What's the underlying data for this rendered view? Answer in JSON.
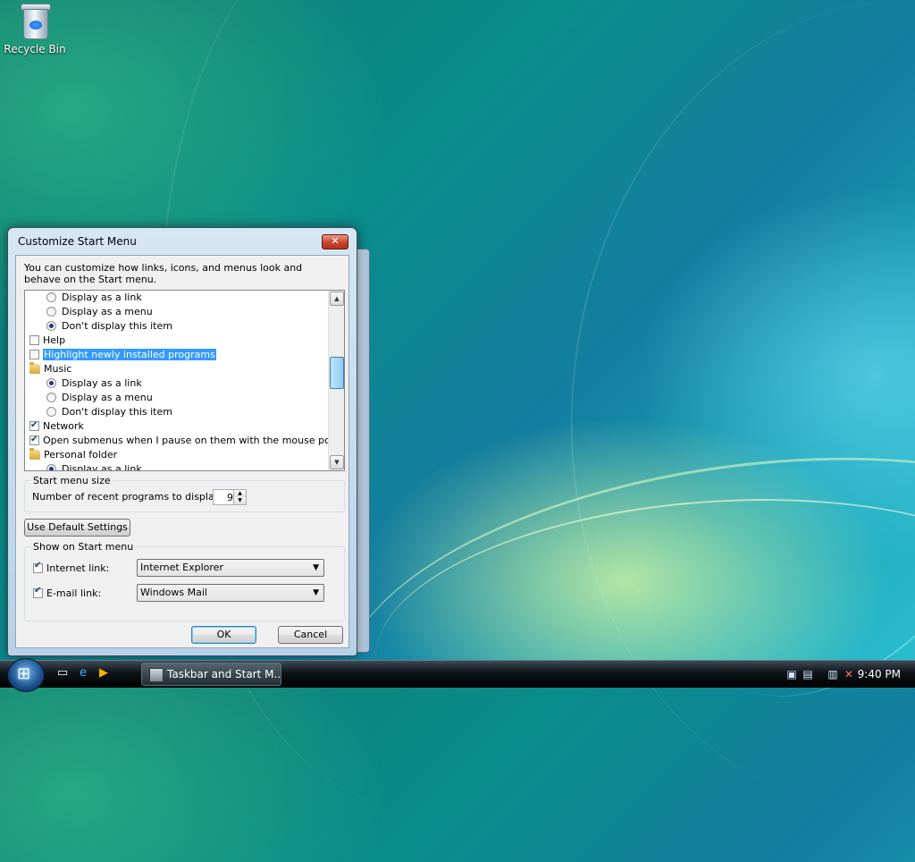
{
  "desktop": {
    "icons": [
      {
        "label": "Recycle Bin",
        "icon": "recycle-bin-icon"
      }
    ]
  },
  "dialog": {
    "title": "Customize Start Menu",
    "close_label": "✕",
    "intro": "You can customize how links, icons, and menus look and behave on the Start menu.",
    "list_items": [
      {
        "type": "radio",
        "label": "Display as a link",
        "checked": false
      },
      {
        "type": "radio",
        "label": "Display as a menu",
        "checked": false
      },
      {
        "type": "radio",
        "label": "Don't display this item",
        "checked": true
      },
      {
        "type": "checkbox",
        "label": "Help",
        "checked": false
      },
      {
        "type": "checkbox",
        "label": "Highlight newly installed programs",
        "checked": false,
        "selected": true
      },
      {
        "type": "folder",
        "label": "Music"
      },
      {
        "type": "radio",
        "label": "Display as a link",
        "checked": true
      },
      {
        "type": "radio",
        "label": "Display as a menu",
        "checked": false
      },
      {
        "type": "radio",
        "label": "Don't display this item",
        "checked": false
      },
      {
        "type": "checkbox",
        "label": "Network",
        "checked": true
      },
      {
        "type": "checkbox",
        "label": "Open submenus when I pause on them with the mouse pointer",
        "checked": true
      },
      {
        "type": "folder",
        "label": "Personal folder"
      },
      {
        "type": "radio",
        "label": "Display as a link",
        "checked": true
      }
    ],
    "start_menu_size": {
      "group_label": "Start menu size",
      "recent_label": "Number of recent programs to display:",
      "recent_value": "9"
    },
    "default_button": "Use Default Settings",
    "show_on_start": {
      "group_label": "Show on Start menu",
      "internet_label": "Internet link:",
      "internet_checked": true,
      "internet_value": "Internet Explorer",
      "email_label": "E-mail link:",
      "email_checked": true,
      "email_value": "Windows Mail"
    },
    "ok_label": "OK",
    "cancel_label": "Cancel"
  },
  "taskbar": {
    "start_icon": "windows-orb-icon",
    "quick_launch": [
      "show-desktop-icon",
      "internet-explorer-icon",
      "media-player-icon"
    ],
    "task_button_label": "Taskbar and Start M...",
    "tray_icons": [
      "network-icon",
      "wireless-icon",
      "monitor-icon",
      "volume-muted-icon"
    ],
    "clock": "9:40 PM"
  },
  "colors": {
    "selection": "#3399ff",
    "desktop_accent": "#0a8c8a",
    "close_button": "#c8452d"
  }
}
